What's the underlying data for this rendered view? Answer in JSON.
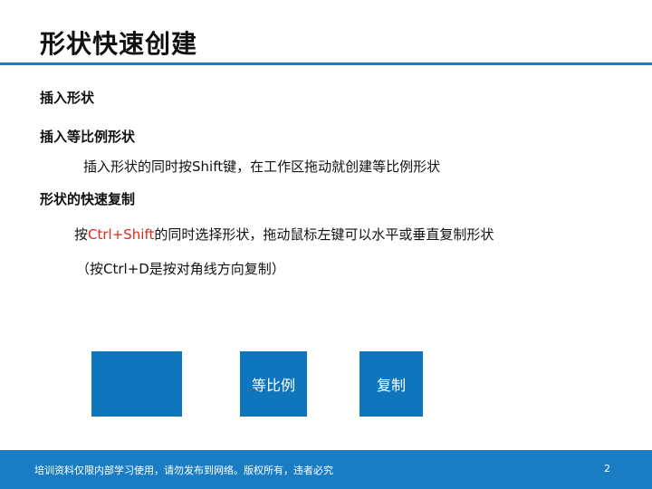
{
  "slide": {
    "title": "形状快速创建",
    "sections": [
      {
        "heading": "插入形状"
      },
      {
        "heading": "插入等比例形状",
        "detail": "插入形状的同时按Shift键，在工作区拖动就创建等比例形状"
      },
      {
        "heading": "形状的快速复制",
        "line1_prefix": "按",
        "line1_highlight": "Ctrl+Shift",
        "line1_suffix": "的同时选择形状，拖动鼠标左键可以水平或垂直复制形状",
        "line2": "（按Ctrl+D是按对角线方向复制）"
      }
    ],
    "shapes": [
      {
        "label": ""
      },
      {
        "label": "等比例"
      },
      {
        "label": "复制"
      }
    ],
    "colors": {
      "accent": "#1a7dc4",
      "shape_fill": "#0f75bd",
      "highlight": "#e0291c"
    }
  },
  "footer": {
    "notice": "培训资料仅限内部学习使用，请勿发布到网络。版权所有，违者必究",
    "page_number": "2"
  }
}
